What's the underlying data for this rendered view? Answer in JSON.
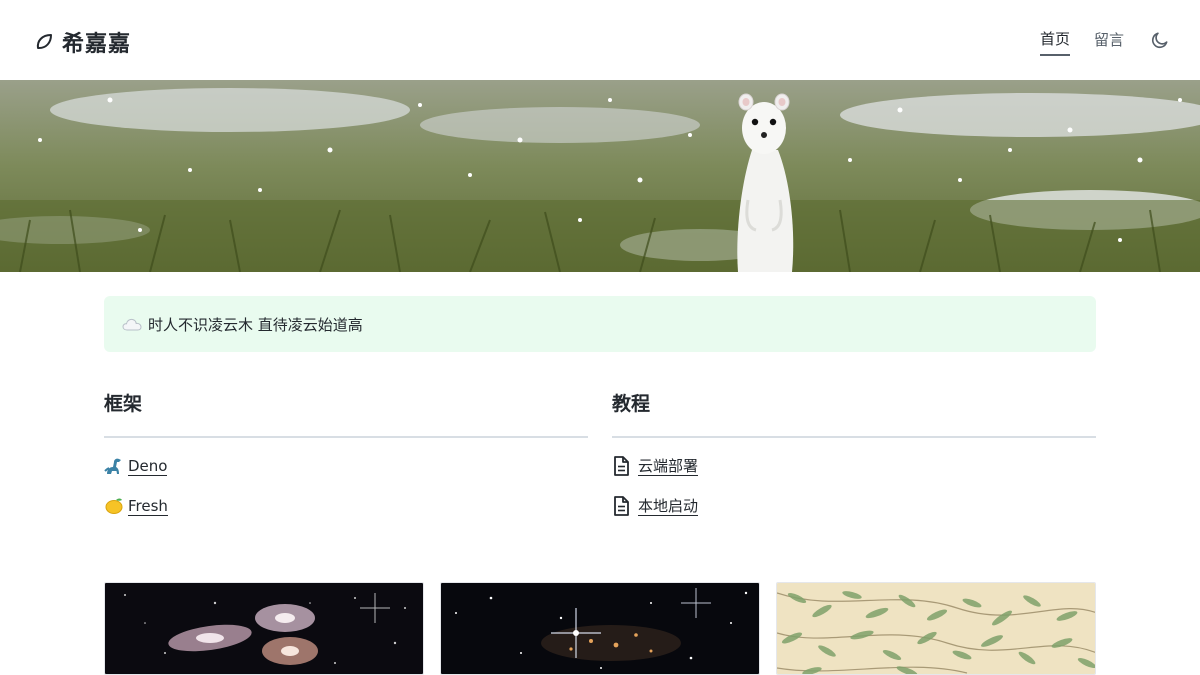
{
  "header": {
    "brand_icon": "leaf-outline-icon",
    "brand_title": "希嘉嘉",
    "nav": [
      {
        "label": "首页",
        "active": true
      },
      {
        "label": "留言",
        "active": false
      }
    ],
    "theme_icon": "moon-icon"
  },
  "hero": {
    "image": "white stoat standing in snowy grass"
  },
  "callout": {
    "icon": "cloud-icon",
    "text": "时人不识凌云木 直待凌云始道高"
  },
  "sections": {
    "frameworks": {
      "title": "框架",
      "links": [
        {
          "icon": "dinosaur-icon",
          "label": "Deno"
        },
        {
          "icon": "lemon-icon",
          "label": "Fresh"
        }
      ]
    },
    "tutorials": {
      "title": "教程",
      "links": [
        {
          "icon": "document-icon",
          "label": "云端部署"
        },
        {
          "icon": "document-icon",
          "label": "本地启动"
        }
      ]
    }
  },
  "cards": [
    {
      "image": "interacting galaxies deep space"
    },
    {
      "image": "deep field star cluster"
    },
    {
      "image": "green willow leaf pattern"
    }
  ],
  "colors": {
    "callout_bg": "#e9fbef",
    "text": "#24292f",
    "muted": "#57606a"
  }
}
